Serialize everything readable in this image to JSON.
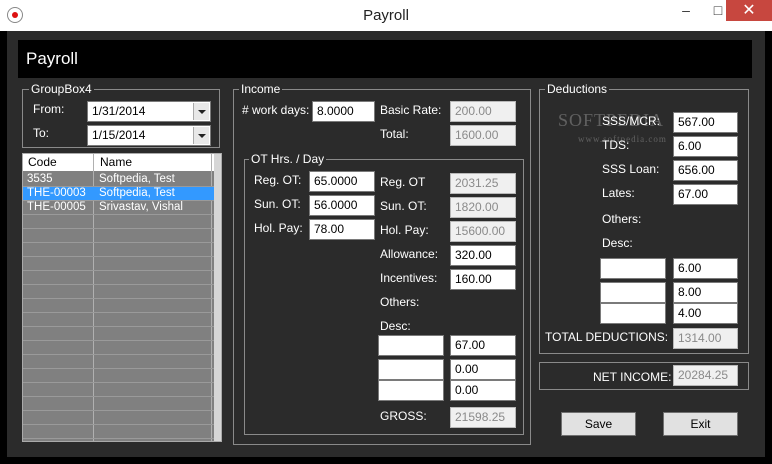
{
  "window": {
    "title": "Payroll"
  },
  "header": {
    "title": "Payroll"
  },
  "period": {
    "group_label": "GroupBox4",
    "from_label": "From:",
    "from_value": "1/31/2014",
    "to_label": "To:",
    "to_value": "1/15/2014"
  },
  "grid": {
    "columns": [
      "Code",
      "Name"
    ],
    "rows": [
      {
        "code": "3535",
        "name": "Softpedia, Test"
      },
      {
        "code": "THE-00003",
        "name": "Softpedia, Test"
      },
      {
        "code": "THE-00005",
        "name": "Srivastav, Vishal"
      }
    ]
  },
  "income": {
    "group_label": "Income",
    "work_days_label": "# work days:",
    "work_days": "8.0000",
    "basic_rate_label": "Basic Rate:",
    "basic_rate": "200.00",
    "total_label": "Total:",
    "total": "1600.00",
    "ot_group_label": "OT Hrs. / Day",
    "reg_ot_label": "Reg. OT:",
    "reg_ot": "65.0000",
    "sun_ot_label": "Sun. OT:",
    "sun_ot": "56.0000",
    "hol_pay_label": "Hol. Pay:",
    "hol_pay": "78.00",
    "reg_ot_amt_label": "Reg. OT",
    "reg_ot_amt": "2031.25",
    "sun_ot_amt_label": "Sun. OT:",
    "sun_ot_amt": "1820.00",
    "hol_pay_amt_label": "Hol. Pay:",
    "hol_pay_amt": "15600.00",
    "allowance_label": "Allowance:",
    "allowance": "320.00",
    "incentives_label": "Incentives:",
    "incentives": "160.00",
    "others_label": "Others:",
    "desc_label": "Desc:",
    "other_rows": [
      {
        "desc": "",
        "amount": "67.00"
      },
      {
        "desc": "",
        "amount": "0.00"
      },
      {
        "desc": "",
        "amount": "0.00"
      }
    ],
    "gross_label": "GROSS:",
    "gross": "21598.25"
  },
  "deductions": {
    "group_label": "Deductions",
    "sss_label": "SSS/MCR:",
    "sss": "567.00",
    "tds_label": "TDS:",
    "tds": "6.00",
    "sss_loan_label": "SSS Loan:",
    "sss_loan": "656.00",
    "lates_label": "Lates:",
    "lates": "67.00",
    "others_label": "Others:",
    "desc_label": "Desc:",
    "other_rows": [
      {
        "desc": "",
        "amount": "6.00"
      },
      {
        "desc": "",
        "amount": "8.00"
      },
      {
        "desc": "",
        "amount": "4.00"
      }
    ],
    "total_label": "TOTAL DEDUCTIONS:",
    "total": "1314.00"
  },
  "net": {
    "label": "NET INCOME:",
    "value": "20284.25"
  },
  "buttons": {
    "save": "Save",
    "exit": "Exit"
  },
  "watermark": {
    "text": "SOFTPEDIA",
    "url": "www.softpedia.com"
  }
}
